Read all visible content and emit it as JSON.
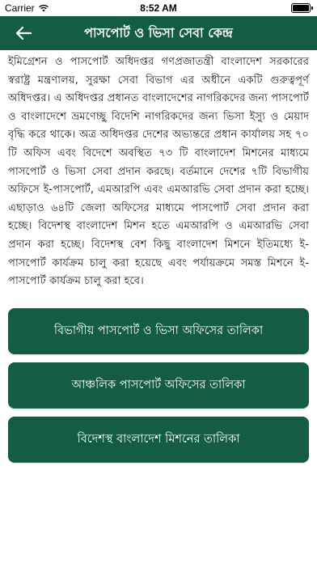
{
  "status_bar": {
    "carrier": "Carrier",
    "time": "8:52 AM"
  },
  "nav": {
    "title": "পাসপোর্ট ও ভিসা সেবা কেন্দ্র",
    "back_icon": "arrow-left-icon"
  },
  "body_text": "ইমিগ্রেশন ও পাসপোর্ট অধিদপ্তর গণপ্রজাতন্ত্রী বাংলাদেশ সরকারের স্বরাষ্ট্র মন্ত্রণালয়, সুরক্ষা সেবা বিভাগ এর অধীনে একটি গুরুত্বপূর্ণ অধিদপ্তর। এ অধিদপ্তর প্রধানত বাংলাদেশের নাগরিকদের জন্য পাসপোর্ট ও বাংলাদেশে ভ্রমণেচ্ছু বিদেশি নাগরিকদের জন্য ভিসা ইস্যু ও মেয়াদ বৃদ্ধি করে থাকে। অত্র অধিদপ্তর দেশের অভ্যন্তরে প্রধান কার্যালয় সহ ৭০ টি অফিস এবং বিদেশে অবস্থিত ৭৩ টি বাংলাদেশ মিশনের মাধ্যমে পাসপোর্ট ও ভিসা সেবা প্রদান করছে। বর্তমানে দেশের ৭টি বিভাগীয় অফিসে ই-পাসপোর্ট, এমআরপি এবং এমআরভি সেবা প্রদান করা হচ্ছে। এছাড়াও ৬৪টি জেলা অফিসের মাধ্যমে পাসপোর্ট সেবা প্রদান করা হচ্ছে। বিদেশস্থ বাংলাদেশ মিশন হতে এমআরপি ও এমআরভি সেবা প্রদান করা হচ্ছে। বিদেশস্থ বেশ কিছু বাংলাদেশ মিশনে ইতিমধ্যে ই-পাসপোর্ট কার্যক্রম চালু করা হয়েছে এবং পর্যায়ক্রমে সমস্ত মিশনে ই-পাসপোর্ট কার্যক্রম চালু করা হবে।",
  "buttons": [
    {
      "label": "বিভাগীয় পাসপোর্ট ও ভিসা অফিসের তালিকা"
    },
    {
      "label": "আঞ্চলিক পাসপোর্ট অফিসের তালিকা"
    },
    {
      "label": "বিদেশস্থ বাংলাদেশ মিশনের তালিকা"
    }
  ],
  "colors": {
    "primary": "#145c43",
    "text": "#222222",
    "background": "#ffffff"
  }
}
